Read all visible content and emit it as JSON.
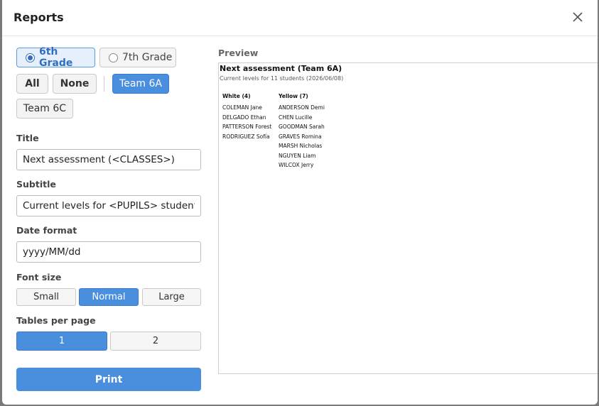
{
  "dialog": {
    "title": "Reports",
    "close_icon": "close-icon"
  },
  "grades": [
    {
      "label": "6th Grade",
      "selected": true
    },
    {
      "label": "7th Grade",
      "selected": false
    }
  ],
  "class_filter": {
    "all_label": "All",
    "none_label": "None",
    "teams": [
      {
        "label": "Team 6A",
        "active": true
      },
      {
        "label": "Team 6C",
        "active": false
      }
    ]
  },
  "form": {
    "title_label": "Title",
    "title_value": "Next assessment (<CLASSES>)",
    "subtitle_label": "Subtitle",
    "subtitle_value": "Current levels for <PUPILS> students (<DATE>)",
    "date_format_label": "Date format",
    "date_format_value": "yyyy/MM/dd",
    "font_size_label": "Font size",
    "font_sizes": [
      "Small",
      "Normal",
      "Large"
    ],
    "font_size_selected": "Normal",
    "tables_label": "Tables per page",
    "tables_options": [
      "1",
      "2"
    ],
    "tables_selected": "1",
    "print_label": "Print"
  },
  "preview": {
    "label": "Preview",
    "title": "Next assessment (Team 6A)",
    "subtitle": "Current levels for 11 students (2026/06/08)",
    "columns": [
      {
        "header": "White (4)",
        "names": [
          "COLEMAN Jane",
          "DELGADO Ethan",
          "PATTERSON Forest",
          "RODRIGUEZ Sofía"
        ]
      },
      {
        "header": "Yellow (7)",
        "names": [
          "ANDERSON Demi",
          "CHEN Lucille",
          "GOODMAN Sarah",
          "GRAVES Romina",
          "MARSH Nicholas",
          "NGUYEN Liam",
          "WILCOX Jerry"
        ]
      }
    ]
  },
  "colors": {
    "accent": "#4a8ede",
    "selected_grade_bg": "#e6f0fc"
  }
}
